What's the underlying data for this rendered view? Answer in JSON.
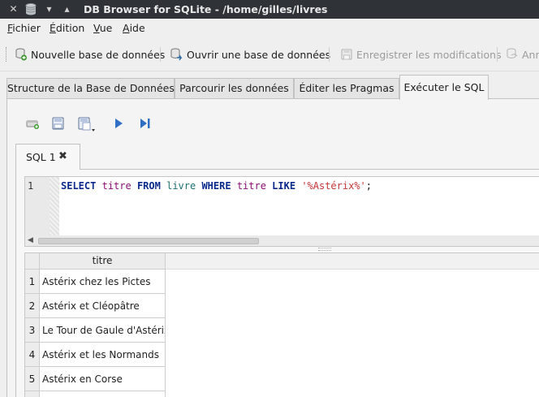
{
  "window": {
    "title": "DB Browser for SQLite - /home/gilles/livres"
  },
  "menu": {
    "items": [
      {
        "underline": "F",
        "rest": "ichier"
      },
      {
        "underline": "É",
        "rest": "dition"
      },
      {
        "underline": "V",
        "rest": "ue"
      },
      {
        "underline": "A",
        "rest": "ide"
      }
    ]
  },
  "toolbar": {
    "new_db": "Nouvelle base de données",
    "open_db": "Ouvrir une base de données",
    "save_changes": "Enregistrer les modifications",
    "cut_off": "Ann"
  },
  "tabs": [
    {
      "label": "Structure de la Base de Données"
    },
    {
      "label": "Parcourir les données"
    },
    {
      "label": "Éditer les Pragmas"
    },
    {
      "label": "Exécuter le SQL"
    }
  ],
  "sql_tab": {
    "label": "SQL 1",
    "close": "✖"
  },
  "editor": {
    "line_number": "1",
    "tokens": {
      "select": "SELECT",
      "col": "titre",
      "from": "FROM",
      "table": "livre",
      "where": "WHERE",
      "col2": "titre",
      "like": "LIKE",
      "pattern": "'%Astérix%'",
      "semicolon": ";"
    }
  },
  "results": {
    "column": "titre",
    "rows": [
      {
        "n": "1",
        "titre": "Astérix chez les Pictes"
      },
      {
        "n": "2",
        "titre": "Astérix et Cléopâtre"
      },
      {
        "n": "3",
        "titre": "Le Tour de Gaule d'Astérix"
      },
      {
        "n": "4",
        "titre": "Astérix et les Normands"
      },
      {
        "n": "5",
        "titre": "Astérix en Corse"
      }
    ]
  },
  "colors": {
    "titlebar": "#2f3337",
    "keyword": "#0b2a8c",
    "identifier": "#8a0f75",
    "table": "#1c6f6f",
    "string": "#c23636"
  }
}
